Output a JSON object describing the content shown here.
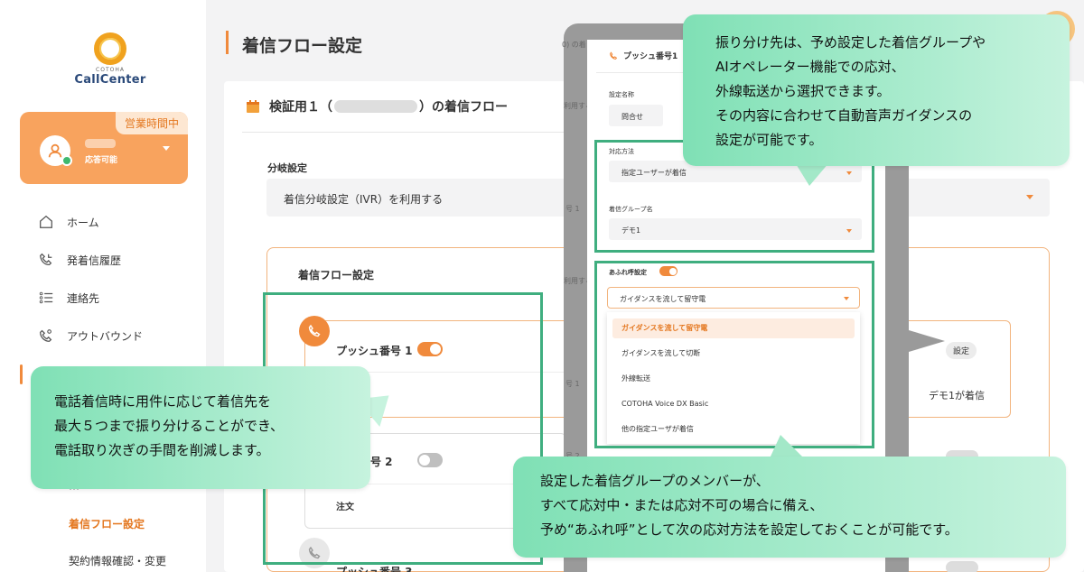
{
  "logo": {
    "small": "COTOHA",
    "main": "CallCenter"
  },
  "status": {
    "tag": "営業時間中",
    "sub": "応答可能"
  },
  "nav": {
    "home": "ホーム",
    "history": "発着信履歴",
    "contacts": "連絡先",
    "outbound": "アウトバウンド",
    "partial": "…",
    "flow": "着信フロー設定",
    "contract": "契約情報確認・変更"
  },
  "page": {
    "title": "着信フロー設定"
  },
  "panel": {
    "head_prefix": "検証用１（",
    "head_suffix": "）の着信フロー",
    "branch_label": "分岐設定",
    "branch_value": "着信分岐設定（IVR）を利用する",
    "flow_label": "着信フロー設定"
  },
  "push": {
    "p1": "プッシュ番号 1",
    "p1_button": "設定",
    "p1_note": "デモ1が着信",
    "p2": "ュ番号 2",
    "p2_item": "注文",
    "p3": "プッシュ番号 3"
  },
  "fragments": {
    "f1": "0) の着",
    "f2": "利用する",
    "f3": "号 1",
    "f4": "利用する",
    "f5": "号 1",
    "f6": "号 2"
  },
  "dialog": {
    "title": "プッシュ番号1",
    "name_label": "設定名称",
    "name_value": "問合せ",
    "method_label": "対応方法",
    "method_value": "指定ユーザーが着信",
    "group_label": "着信グループ名",
    "group_value": "デモ1",
    "overflow_label": "あふれ呼設定",
    "overflow_value": "ガイダンスを流して留守電",
    "options": [
      "ガイダンスを流して留守電",
      "ガイダンスを流して切断",
      "外線転送",
      "COTOHA Voice DX Basic",
      "他の指定ユーザが着信"
    ]
  },
  "callouts": {
    "top": [
      "振り分け先は、予め設定した着信グループや",
      "AIオペレーター機能での応対、",
      "外線転送から選択できます。",
      "その内容に合わせて自動音声ガイダンスの",
      "設定が可能です。"
    ],
    "left": [
      "電話着信時に用件に応じて着信先を",
      "最大５つまで振り分けることができ、",
      "電話取り次ぎの手間を削減します。"
    ],
    "bottom": [
      "設定した着信グループのメンバーが、",
      "すべて応対中・または応対不可の場合に備え、",
      "予め“あふれ呼”として次の応対方法を設定しておくことが可能です。"
    ]
  },
  "colors": {
    "accent": "#f08a3c",
    "highlight": "#3fae7f",
    "callout": "#7fe0b5"
  }
}
